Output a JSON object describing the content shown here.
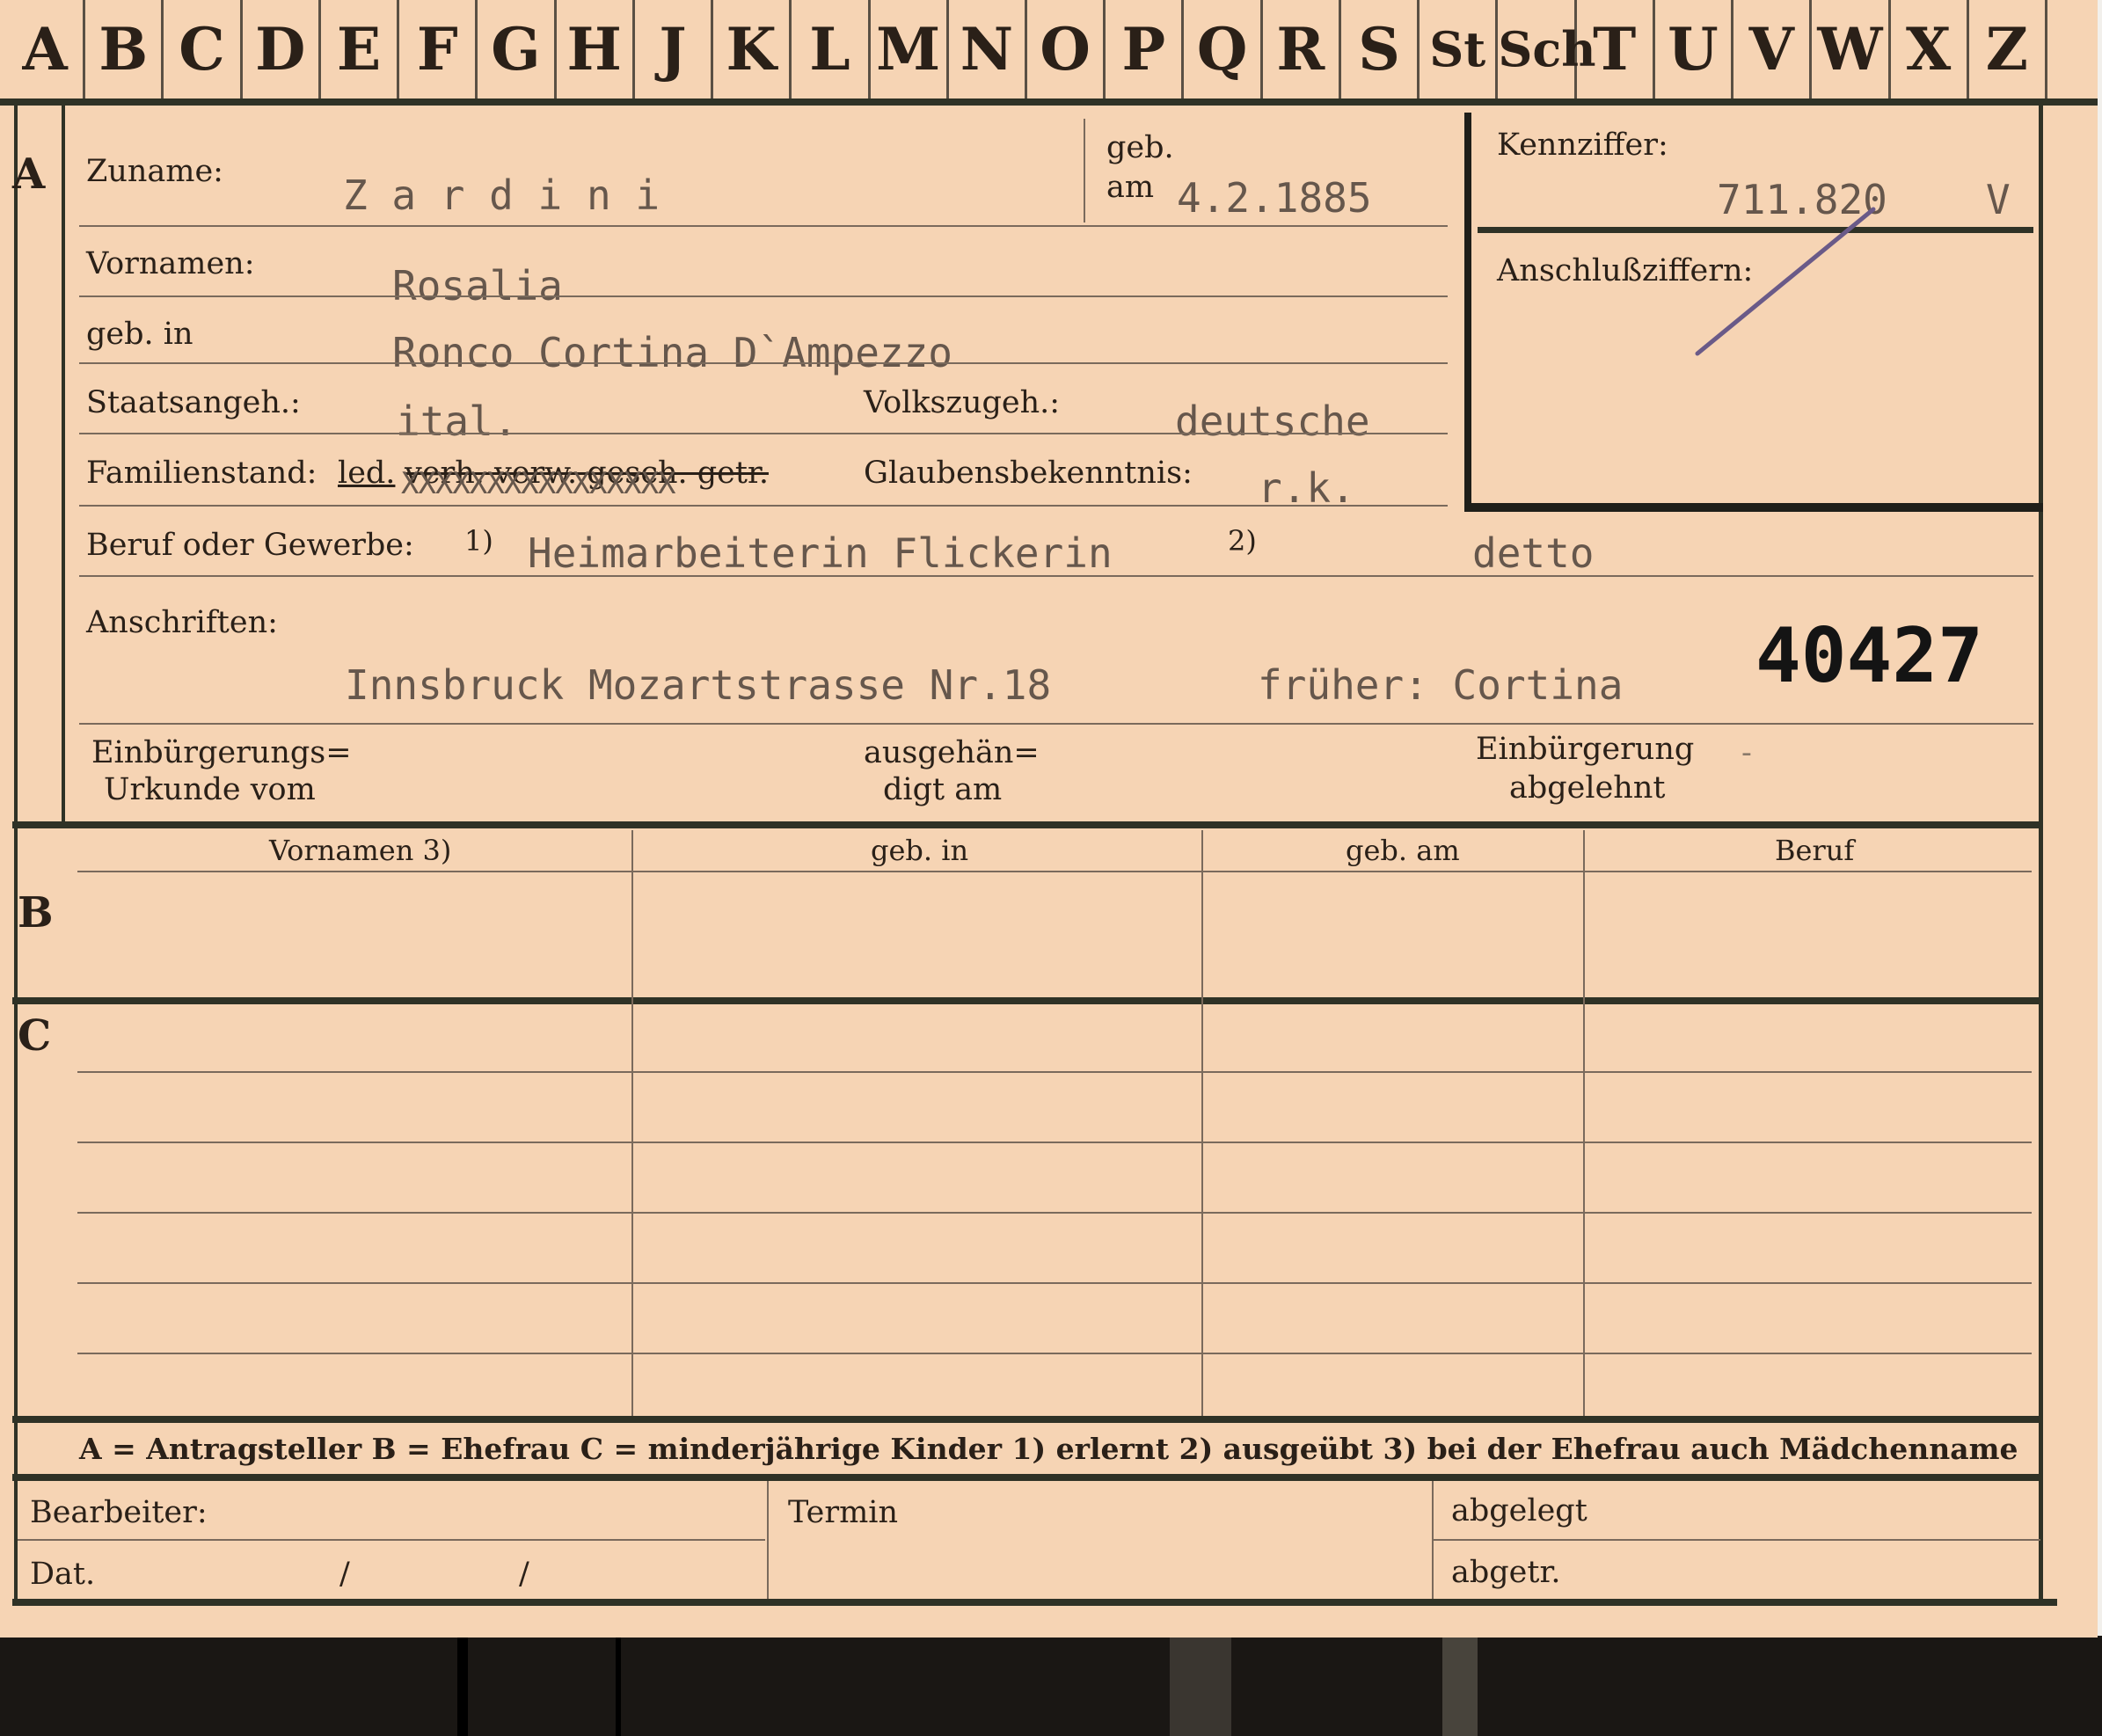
{
  "tabs": [
    "A",
    "B",
    "C",
    "D",
    "E",
    "F",
    "G",
    "H",
    "J",
    "K",
    "L",
    "M",
    "N",
    "O",
    "P",
    "Q",
    "R",
    "S",
    "St",
    "Sch",
    "T",
    "U",
    "V",
    "W",
    "X",
    "Z"
  ],
  "section_labels": {
    "a": "A",
    "b": "B",
    "c": "C"
  },
  "section_a": {
    "surname_label": "Zuname:",
    "surname_value": "Z a r d i n i",
    "born_on_label_1": "geb.",
    "born_on_label_2": "am",
    "born_on_value": "4.2.1885",
    "first_names_label": "Vornamen:",
    "first_names_value": "Rosalia",
    "born_in_label": "geb. in",
    "born_in_value": "Ronco  Cortina D`Ampezzo",
    "citizenship_label": "Staatsangeh.:",
    "citizenship_value": "ital.",
    "ethnicity_label": "Volkszugeh.:",
    "ethnicity_value": "deutsche",
    "marital_label": "Familienstand:",
    "marital_selected": "led.",
    "marital_struck": "verh. verw. gesch. getr.",
    "marital_overtype": "XXXXXXXXXXXXXXXX",
    "religion_label": "Glaubensbekenntnis:",
    "religion_value": "r.k.",
    "occupation_label": "Beruf oder Gewerbe:",
    "occupation_mark_1": "1)",
    "occupation_value_1": "Heimarbeiterin Flickerin",
    "occupation_mark_2": "2)",
    "occupation_value_2": "detto",
    "address_label": "Anschriften:",
    "address_value": "Innsbruck Mozartstrasse  Nr.18",
    "previous_address": "früher: Cortina",
    "file_number": "40427",
    "naturalization_cert_label_1": "Einbürgerungs=",
    "naturalization_cert_label_2": "Urkunde vom",
    "handed_out_label_1": "ausgehän=",
    "handed_out_label_2": "digt am",
    "naturalization_denied_label_1": "Einbürgerung",
    "naturalization_denied_label_2": "abgelehnt",
    "naturalization_denied_value": "-"
  },
  "reference_box": {
    "code_label": "Kennziffer:",
    "code_value": "711.820",
    "code_suffix": "V",
    "sub_codes_label": "Anschlußziffern:"
  },
  "section_b": {
    "columns": [
      "Vornamen 3)",
      "geb. in",
      "geb. am",
      "Beruf"
    ]
  },
  "legend": "A = Antragsteller    B = Ehefrau    C = minderjährige Kinder    1) erlernt    2) ausgeübt    3) bei der Ehefrau auch Mädchenname",
  "footer": {
    "processor_label": "Bearbeiter:",
    "date_label": "Dat.",
    "date_sep_1": "/",
    "date_sep_2": "/",
    "deadline_label": "Termin",
    "filed_label": "abgelegt",
    "separated_label": "abgetr."
  }
}
